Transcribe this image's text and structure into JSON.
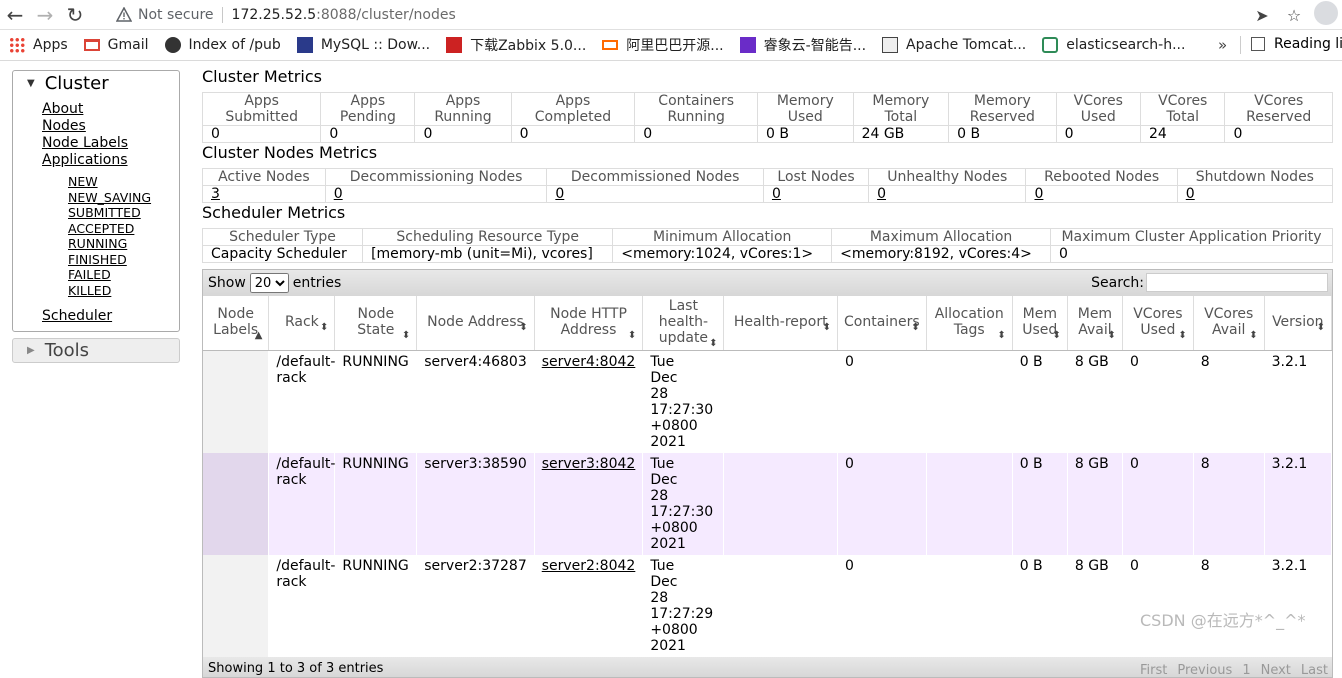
{
  "browser": {
    "not_secure": "Not secure",
    "host": "172.25.52.5",
    "path": ":8088/cluster/nodes",
    "bookmarks": [
      "Apps",
      "Gmail",
      "Index of /pub",
      "MySQL :: Dow...",
      "下载Zabbix 5.0...",
      "阿里巴巴开源...",
      "睿象云-智能告...",
      "Apache Tomcat...",
      "elasticsearch-h..."
    ],
    "more": "»",
    "reading_list": "Reading list",
    "bookmark_icon_colors": [
      "#ea4335",
      "#db4437",
      "#333333",
      "#2a3a8a",
      "#cc2222",
      "#ff6a00",
      "#6a2cc8",
      "#444444",
      "#2e8b57"
    ]
  },
  "sidebar": {
    "cluster_title": "Cluster",
    "links": [
      "About",
      "Nodes",
      "Node Labels",
      "Applications"
    ],
    "app_states": [
      "NEW",
      "NEW_SAVING",
      "SUBMITTED",
      "ACCEPTED",
      "RUNNING",
      "FINISHED",
      "FAILED",
      "KILLED"
    ],
    "scheduler": "Scheduler",
    "tools_title": "Tools"
  },
  "cluster_metrics": {
    "title": "Cluster Metrics",
    "headers": [
      [
        "Apps",
        "Submitted"
      ],
      [
        "Apps",
        "Pending"
      ],
      [
        "Apps",
        "Running"
      ],
      [
        "Apps",
        "Completed"
      ],
      [
        "Containers",
        "Running"
      ],
      [
        "Memory",
        "Used"
      ],
      [
        "Memory",
        "Total"
      ],
      [
        "Memory",
        "Reserved"
      ],
      [
        "VCores",
        "Used"
      ],
      [
        "VCores",
        "Total"
      ],
      [
        "VCores",
        "Reserved"
      ]
    ],
    "values": [
      "0",
      "0",
      "0",
      "0",
      "0",
      "0 B",
      "24 GB",
      "0 B",
      "0",
      "24",
      "0"
    ]
  },
  "nodes_metrics": {
    "title": "Cluster Nodes Metrics",
    "headers": [
      "Active Nodes",
      "Decommissioning Nodes",
      "Decommissioned Nodes",
      "Lost Nodes",
      "Unhealthy Nodes",
      "Rebooted Nodes",
      "Shutdown Nodes"
    ],
    "values": [
      "3",
      "0",
      "0",
      "0",
      "0",
      "0",
      "0"
    ]
  },
  "scheduler_metrics": {
    "title": "Scheduler Metrics",
    "headers": [
      "Scheduler Type",
      "Scheduling Resource Type",
      "Minimum Allocation",
      "Maximum Allocation",
      "Maximum Cluster Application Priority"
    ],
    "values": [
      "Capacity Scheduler",
      "[memory-mb (unit=Mi), vcores]",
      "<memory:1024, vCores:1>",
      "<memory:8192, vCores:4>",
      "0"
    ]
  },
  "nodes_table": {
    "show_label": "Show",
    "entries_value": "20",
    "entries_label": "entries",
    "search_label": "Search:",
    "headers": [
      [
        "Node",
        "Labels"
      ],
      [
        "Rack"
      ],
      [
        "Node",
        "State"
      ],
      [
        "Node Address"
      ],
      [
        "Node HTTP",
        "Address"
      ],
      [
        "Last",
        "health-",
        "update"
      ],
      [
        "Health-report"
      ],
      [
        "Containers"
      ],
      [
        "Allocation",
        "Tags"
      ],
      [
        "Mem",
        "Used"
      ],
      [
        "Mem",
        "Avail"
      ],
      [
        "VCores",
        "Used"
      ],
      [
        "VCores",
        "Avail"
      ],
      [
        "Version"
      ]
    ],
    "rows": [
      [
        "",
        "/default-rack",
        "RUNNING",
        "server4:46803",
        "server4:8042",
        "Tue Dec 28 17:27:30 +0800 2021",
        "",
        "0",
        "",
        "0 B",
        "8 GB",
        "0",
        "8",
        "3.2.1"
      ],
      [
        "",
        "/default-rack",
        "RUNNING",
        "server3:38590",
        "server3:8042",
        "Tue Dec 28 17:27:30 +0800 2021",
        "",
        "0",
        "",
        "0 B",
        "8 GB",
        "0",
        "8",
        "3.2.1"
      ],
      [
        "",
        "/default-rack",
        "RUNNING",
        "server2:37287",
        "server2:8042",
        "Tue Dec 28 17:27:29 +0800 2021",
        "",
        "0",
        "",
        "0 B",
        "8 GB",
        "0",
        "8",
        "3.2.1"
      ]
    ],
    "info": "Showing 1 to 3 of 3 entries",
    "pager": [
      "First",
      "Previous",
      "1",
      "Next",
      "Last"
    ]
  },
  "watermark": "CSDN @在远方*^_^*"
}
